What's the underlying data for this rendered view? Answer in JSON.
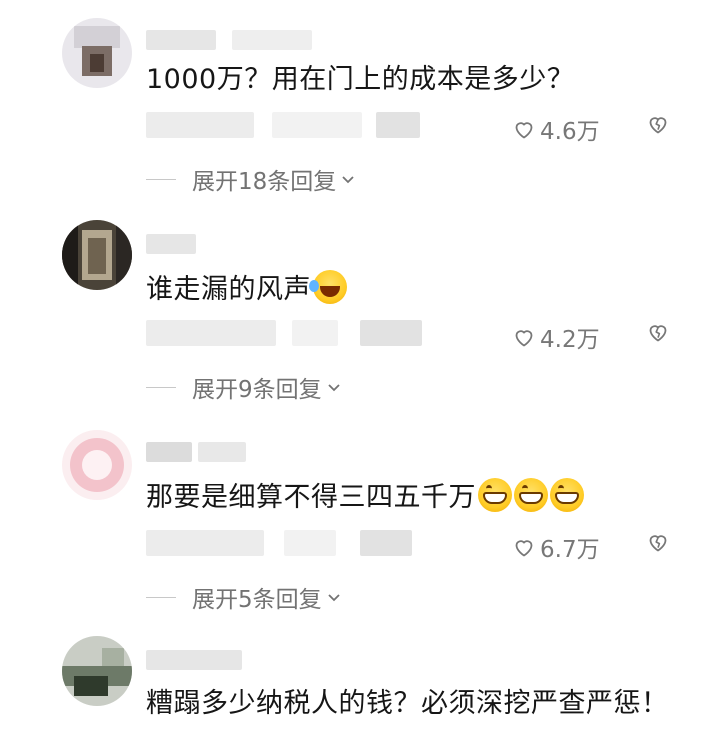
{
  "comments": [
    {
      "text": "1000万？用在门上的成本是多少？",
      "emojis": [],
      "likes": "4.6万",
      "expand_label": "展开18条回复",
      "avatar_colors": [
        "#d9d9df",
        "#a9a3a8",
        "#6b5a52",
        "#e8e6ea"
      ]
    },
    {
      "text": "谁走漏的风声",
      "emojis": [
        "laugh-cry-emoji"
      ],
      "likes": "4.2万",
      "expand_label": "展开9条回复",
      "avatar_colors": [
        "#2a2724",
        "#8c7b5e",
        "#4d463c",
        "#b7ad98"
      ]
    },
    {
      "text": "那要是细算不得三四五千万",
      "emojis": [
        "grin-emoji",
        "grin-emoji",
        "grin-emoji"
      ],
      "likes": "6.7万",
      "expand_label": "展开5条回复",
      "avatar_colors": [
        "#f6d0d6",
        "#f0b6c0",
        "#fbe8eb",
        "#e9a3ae"
      ]
    },
    {
      "text": "糟蹋多少纳税人的钱？必须深挖严查严惩！",
      "emojis": [],
      "avatar_colors": [
        "#c7cbc4",
        "#5c6b58",
        "#2f3a2c",
        "#9aa593"
      ]
    }
  ],
  "icons": {
    "like": "heart-outline-icon",
    "dislike": "broken-heart-icon",
    "expand": "chevron-down-icon"
  },
  "colors": {
    "text": "#161616",
    "secondary": "#737373",
    "placeholder_blur": "#e6e6e6"
  }
}
